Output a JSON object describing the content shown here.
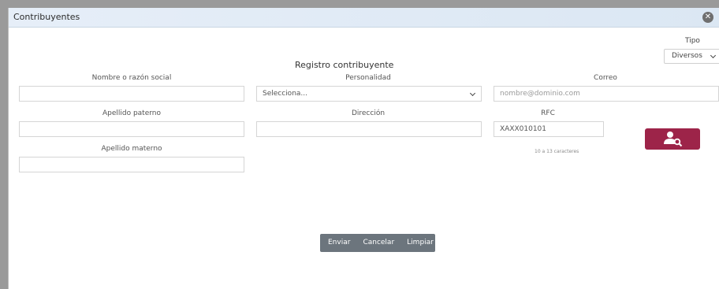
{
  "window": {
    "title": "Contribuyentes"
  },
  "tipo": {
    "label": "Tipo",
    "selected": "Diversos"
  },
  "form": {
    "heading": "Registro contribuyente",
    "nombre_label": "Nombre o razón social",
    "personalidad_label": "Personalidad",
    "personalidad_value": "Selecciona...",
    "correo_label": "Correo",
    "correo_placeholder": "nombre@dominio.com",
    "apellido_paterno_label": "Apellido paterno",
    "direccion_label": "Dirección",
    "rfc_label": "RFC",
    "rfc_placeholder": "XAXX010101",
    "rfc_hint": "10 a 13 caracteres",
    "apellido_materno_label": "Apellido materno"
  },
  "actions": {
    "enviar": "Enviar",
    "cancelar": "Cancelar",
    "limpiar": "Limpiar"
  },
  "icons": {
    "close": "close-icon",
    "search_user": "user-search-icon",
    "dropdown": "chevron-down-icon"
  },
  "colors": {
    "accent": "#9d2449",
    "button_group": "#6c757d",
    "titlebar": "#dbe7f3"
  }
}
